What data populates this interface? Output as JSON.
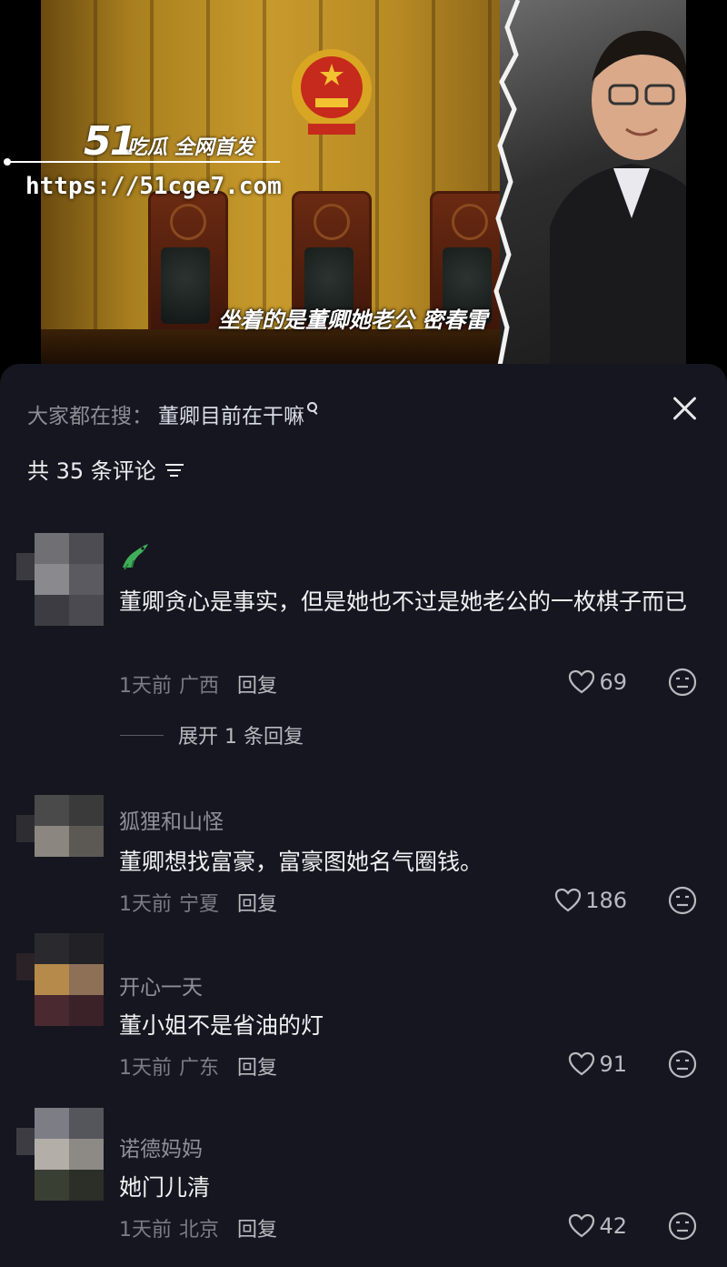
{
  "video": {
    "watermark_number": "51",
    "watermark_text": "吃瓜 全网首发",
    "watermark_url": "https://51cge7.com",
    "caption": "坐着的是董卿她老公 密春雷"
  },
  "sheet": {
    "search_prefix": "大家都在搜：",
    "search_term": "董卿目前在干嘛",
    "comment_count_label": "共 35 条评论"
  },
  "comments": [
    {
      "name": "",
      "badge_icon": "crocodile-icon",
      "text": "董卿贪心是事实，但是她也不过是她老公的一枚棋子而已",
      "time": "1天前",
      "location": "广西",
      "reply_label": "回复",
      "likes": "69",
      "expand_label": "展开 1 条回复",
      "avatar_colors": [
        "#6f6f74",
        "#4c4c52",
        "#8a8a8e",
        "#5a5a60",
        "#3c3c42",
        "#4a4a50"
      ]
    },
    {
      "name": "狐狸和山怪",
      "text": "董卿想找富豪，富豪图她名气圈钱。",
      "time": "1天前",
      "location": "宁夏",
      "reply_label": "回复",
      "likes": "186",
      "avatar_colors": [
        "#4a4a4a",
        "#3a3a3a",
        "#8b8680",
        "#5c5954",
        "#2c2c30",
        "#333338"
      ]
    },
    {
      "name": "开心一天",
      "text": "董小姐不是省油的灯",
      "time": "1天前",
      "location": "广东",
      "reply_label": "回复",
      "likes": "91",
      "avatar_colors": [
        "#2a2a2e",
        "#222226",
        "#b58a4a",
        "#8d7056",
        "#4a2a30",
        "#3a2228"
      ]
    },
    {
      "name": "诺德妈妈",
      "text": "她门儿清",
      "time": "1天前",
      "location": "北京",
      "reply_label": "回复",
      "likes": "42",
      "avatar_colors": [
        "#7d7d86",
        "#55555c",
        "#b3aea8",
        "#8d8a86",
        "#3a3f34",
        "#2c2f28"
      ]
    }
  ]
}
